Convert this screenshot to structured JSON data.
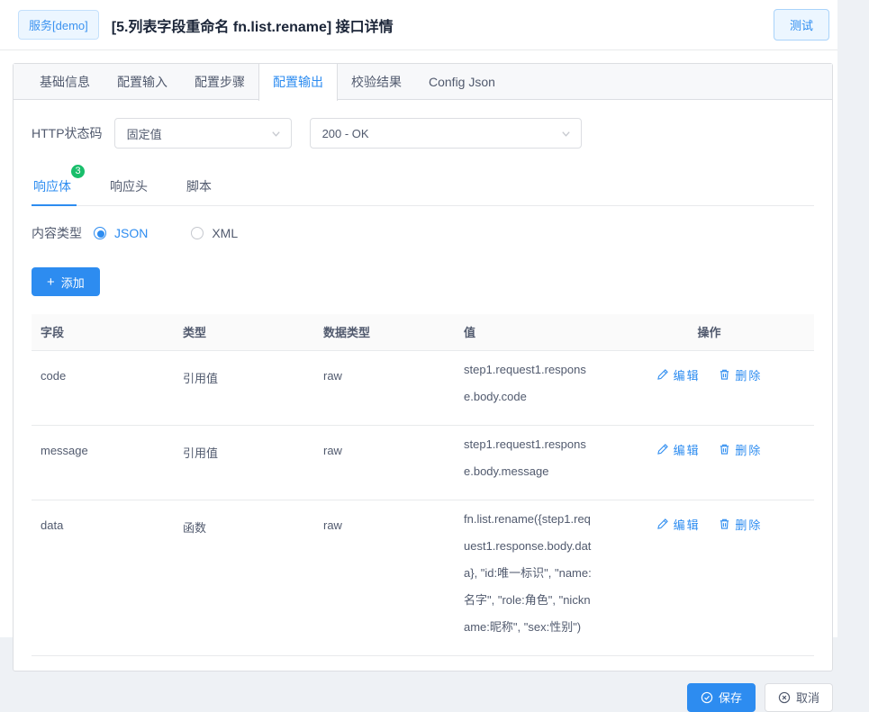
{
  "header": {
    "service_badge": "服务[demo]",
    "title": "[5.列表字段重命名 fn.list.rename] 接口详情",
    "test_button": "测试"
  },
  "tabs": {
    "active": "配置输出",
    "items": [
      {
        "label": "基础信息"
      },
      {
        "label": "配置输入"
      },
      {
        "label": "配置步骤"
      },
      {
        "label": "配置输出"
      },
      {
        "label": "校验结果"
      },
      {
        "label": "Config Json"
      }
    ]
  },
  "http_status": {
    "label": "HTTP状态码",
    "value_type": "固定值",
    "status_code": "200 - OK"
  },
  "response_tabs": {
    "active": "响应体",
    "items": [
      {
        "label": "响应体",
        "badge": "3"
      },
      {
        "label": "响应头"
      },
      {
        "label": "脚本"
      }
    ]
  },
  "content_type": {
    "label": "内容类型",
    "options": [
      {
        "label": "JSON",
        "selected": true
      },
      {
        "label": "XML",
        "selected": false
      }
    ]
  },
  "toolbar": {
    "add_label": "添加"
  },
  "table": {
    "headers": [
      "字段",
      "类型",
      "数据类型",
      "值",
      "操作"
    ],
    "action_labels": {
      "edit": "编辑",
      "delete": "删除"
    },
    "rows": [
      {
        "field": "code",
        "type": "引用值",
        "data_type": "raw",
        "value": "step1.request1.response.body.code"
      },
      {
        "field": "message",
        "type": "引用值",
        "data_type": "raw",
        "value": "step1.request1.response.body.message"
      },
      {
        "field": "data",
        "type": "函数",
        "data_type": "raw",
        "value": "fn.list.rename({step1.request1.response.body.data}, \"id:唯一标识\", \"name:名字\", \"role:角色\", \"nickname:昵称\", \"sex:性别\")"
      }
    ]
  },
  "footer": {
    "save_label": "保存",
    "cancel_label": "取消"
  },
  "colors": {
    "accent": "#2d8cf0",
    "success": "#19be6b",
    "light_blue_bg": "#ecf6ff"
  }
}
